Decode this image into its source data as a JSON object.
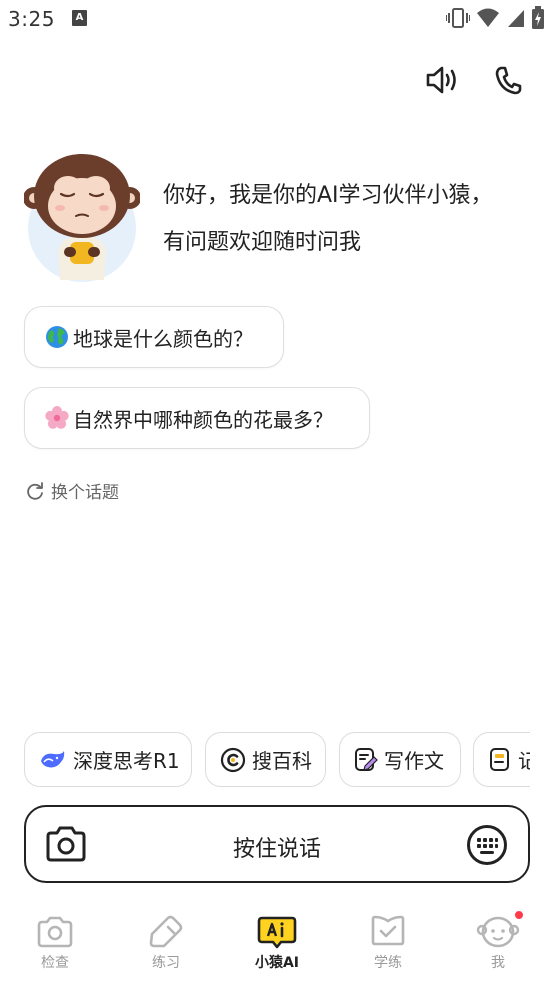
{
  "status_bar": {
    "time": "3:25",
    "notification_badge": "A"
  },
  "greeting": {
    "text": "你好，我是你的AI学习伙伴小猿，有问题欢迎随时问我"
  },
  "suggestions": [
    {
      "emoji_icon": "globe-icon",
      "label": "地球是什么颜色的？"
    },
    {
      "emoji_icon": "cherry-blossom-icon",
      "label": "自然界中哪种颜色的花最多？"
    }
  ],
  "refresh": {
    "label": "换个话题"
  },
  "tools": [
    {
      "icon": "deepseek-whale-icon",
      "label": "深度思考R1"
    },
    {
      "icon": "encyclopedia-icon",
      "label": "搜百科"
    },
    {
      "icon": "writing-icon",
      "label": "写作文"
    },
    {
      "icon": "document-icon",
      "label": "记"
    }
  ],
  "input": {
    "label": "按住说话"
  },
  "nav": [
    {
      "label": "检查",
      "icon": "camera-icon",
      "active": false
    },
    {
      "label": "练习",
      "icon": "pencil-tag-icon",
      "active": false
    },
    {
      "label": "小猿AI",
      "icon": "ai-chat-icon",
      "active": true
    },
    {
      "label": "学练",
      "icon": "checkbook-icon",
      "active": false
    },
    {
      "label": "我",
      "icon": "profile-face-icon",
      "active": false,
      "has_badge": true
    }
  ],
  "colors": {
    "accent_yellow": "#FFD21F",
    "badge_red": "#FF3B4A",
    "inactive_gray": "#9A9A9A",
    "deepseek_blue": "#4D6BFE"
  }
}
